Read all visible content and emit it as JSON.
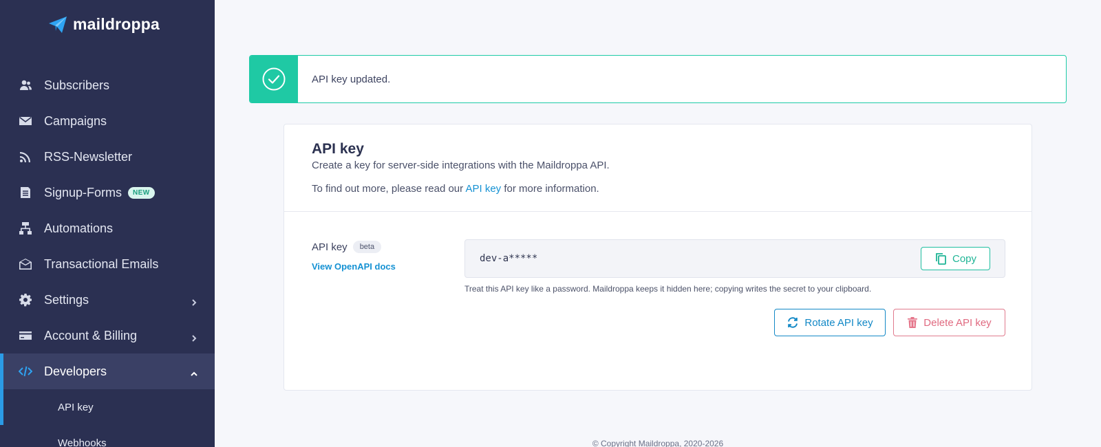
{
  "brand": {
    "name": "maildroppa"
  },
  "sidebar": {
    "items": [
      {
        "label": "Subscribers",
        "icon": "users-icon"
      },
      {
        "label": "Campaigns",
        "icon": "envelope-icon"
      },
      {
        "label": "RSS-Newsletter",
        "icon": "rss-icon"
      },
      {
        "label": "Signup-Forms",
        "icon": "form-icon",
        "badge": "NEW"
      },
      {
        "label": "Automations",
        "icon": "flow-icon"
      },
      {
        "label": "Transactional Emails",
        "icon": "mail-open-icon"
      },
      {
        "label": "Settings",
        "icon": "gear-icon"
      },
      {
        "label": "Account & Billing",
        "icon": "credit-card-icon"
      },
      {
        "label": "Developers",
        "icon": "code-icon"
      }
    ],
    "subitems": [
      {
        "label": "API key"
      },
      {
        "label": "Webhooks"
      }
    ]
  },
  "alert": {
    "message": "API key updated."
  },
  "card": {
    "title": "API key",
    "description": "Create a key for server-side integrations with the Maildroppa API.",
    "more_prefix": "To find out more, please read our ",
    "more_link": "API key",
    "more_suffix": " for more information."
  },
  "api_key": {
    "label": "API key",
    "badge": "beta",
    "docs_link": "View OpenAPI docs",
    "value": "dev-a*****",
    "copy_label": "Copy",
    "hint": "Treat this API key like a password. Maildroppa keeps it hidden here; copying writes the secret to your clipboard.",
    "rotate_label": "Rotate API key",
    "delete_label": "Delete API key"
  },
  "footer": {
    "copyright": "© Copyright Maildroppa, 2020-2026"
  },
  "colors": {
    "sidebar_bg": "#2b3052",
    "accent_blue": "#1491d3",
    "success_green": "#1fc9a4",
    "danger_red": "#e06a80"
  }
}
